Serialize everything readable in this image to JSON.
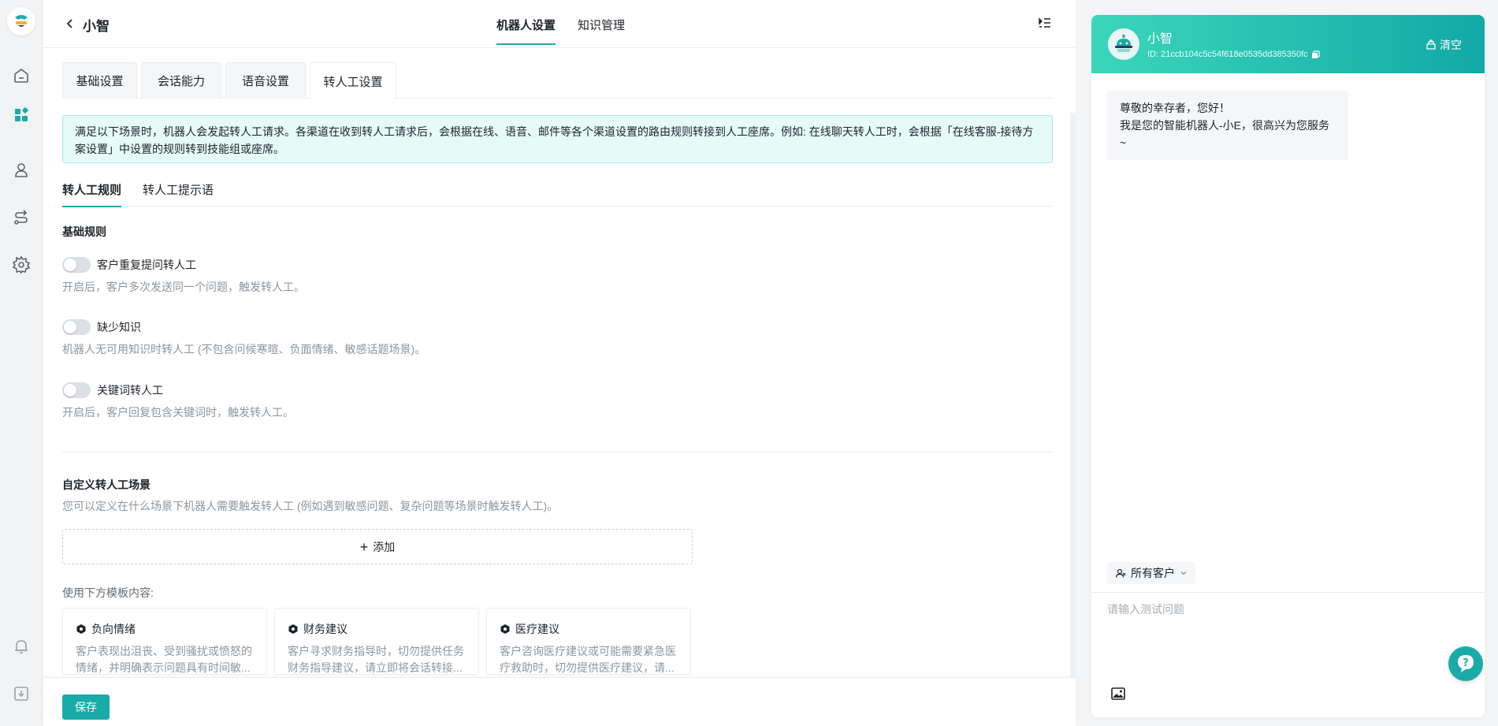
{
  "header": {
    "back_icon": "chevron-left-icon",
    "bot_name": "小智",
    "tabs": [
      {
        "label": "机器人设置",
        "active": true
      },
      {
        "label": "知识管理",
        "active": false
      }
    ],
    "menu_icon": "indent-menu-icon"
  },
  "settings_tabs": [
    {
      "label": "基础设置",
      "active": false
    },
    {
      "label": "会话能力",
      "active": false
    },
    {
      "label": "语音设置",
      "active": false
    },
    {
      "label": "转人工设置",
      "active": true
    }
  ],
  "info_text": "满足以下场景时，机器人会发起转人工请求。各渠道在收到转人工请求后，会根据在线、语音、邮件等各个渠道设置的路由规则转接到人工座席。例如: 在线聊天转人工时，会根据「在线客服-接待方案设置」中设置的规则转到技能组或座席。",
  "sub_tabs": [
    {
      "label": "转人工规则",
      "active": true
    },
    {
      "label": "转人工提示语",
      "active": false
    }
  ],
  "basic_rules": {
    "title": "基础规则",
    "rules": [
      {
        "label": "客户重复提问转人工",
        "enabled": false,
        "desc": "开启后，客户多次发送同一个问题，触发转人工。"
      },
      {
        "label": "缺少知识",
        "enabled": false,
        "desc": "机器人无可用知识时转人工 (不包含问候寒暄、负面情绪、敏感话题场景)。"
      },
      {
        "label": "关键词转人工",
        "enabled": false,
        "desc": "开启后，客户回复包含关键词时，触发转人工。"
      }
    ]
  },
  "custom": {
    "title": "自定义转人工场景",
    "desc": "您可以定义在什么场景下机器人需要触发转人工 (例如遇到敏感问题、复杂问题等场景时触发转人工)。",
    "add_label": "添加",
    "template_hint": "使用下方模板内容:",
    "templates": [
      {
        "title": "负向情绪",
        "desc": "客户表现出沮丧、受到骚扰或愤怒的情绪，并明确表示问题具有时间敏..."
      },
      {
        "title": "财务建议",
        "desc": "客户寻求财务指导时，切勿提供任务财务指导建议，请立即将会话转接..."
      },
      {
        "title": "医疗建议",
        "desc": "客户咨询医疗建议或可能需要紧急医疗救助时，切勿提供医疗建议，请..."
      }
    ]
  },
  "footer": {
    "save_label": "保存"
  },
  "chat": {
    "bot_name": "小智",
    "bot_id": "ID: 21ccb104c5c54f618e0535dd385350fc",
    "clear_label": "清空",
    "greeting_line1": "尊敬的幸存者，您好！",
    "greeting_line2": "我是您的智能机器人-小E，很高兴为您服务~",
    "customer_filter": "所有客户",
    "input_placeholder": "请输入测试问题"
  },
  "sidebar": {
    "icons": [
      "home-icon",
      "apps-icon",
      "user-icon",
      "flow-icon",
      "settings-icon",
      "bell-icon",
      "download-icon"
    ]
  },
  "colors": {
    "accent": "#1aaba8",
    "header_gradient_start": "#3bd6bb",
    "header_gradient_end": "#12a9a6",
    "info_bg": "#e6faf7"
  }
}
